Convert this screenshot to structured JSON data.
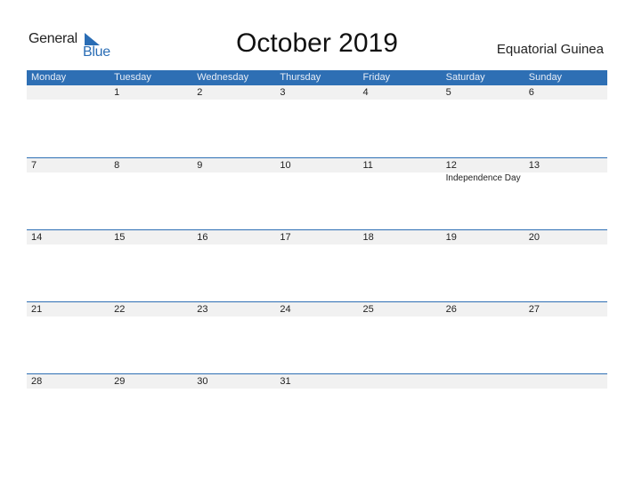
{
  "logo": {
    "line1": "General",
    "line2": "Blue"
  },
  "header": {
    "title": "October 2019",
    "country": "Equatorial Guinea"
  },
  "colors": {
    "accent": "#2e6fb4",
    "date_bar": "#f1f1f1"
  },
  "weekdays": [
    "Monday",
    "Tuesday",
    "Wednesday",
    "Thursday",
    "Friday",
    "Saturday",
    "Sunday"
  ],
  "weeks": [
    {
      "dates": [
        "",
        "1",
        "2",
        "3",
        "4",
        "5",
        "6"
      ],
      "events": [
        "",
        "",
        "",
        "",
        "",
        "",
        ""
      ]
    },
    {
      "dates": [
        "7",
        "8",
        "9",
        "10",
        "11",
        "12",
        "13"
      ],
      "events": [
        "",
        "",
        "",
        "",
        "",
        "Independence Day",
        ""
      ]
    },
    {
      "dates": [
        "14",
        "15",
        "16",
        "17",
        "18",
        "19",
        "20"
      ],
      "events": [
        "",
        "",
        "",
        "",
        "",
        "",
        ""
      ]
    },
    {
      "dates": [
        "21",
        "22",
        "23",
        "24",
        "25",
        "26",
        "27"
      ],
      "events": [
        "",
        "",
        "",
        "",
        "",
        "",
        ""
      ]
    },
    {
      "dates": [
        "28",
        "29",
        "30",
        "31",
        "",
        "",
        ""
      ],
      "events": [
        "",
        "",
        "",
        "",
        "",
        "",
        ""
      ]
    }
  ]
}
